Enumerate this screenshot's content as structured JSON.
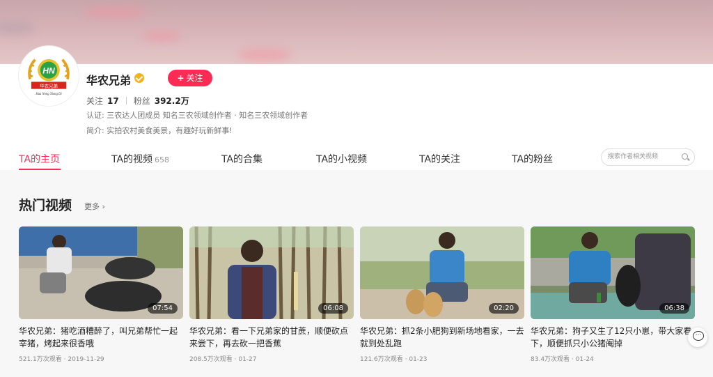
{
  "profile": {
    "name": "华农兄弟",
    "follow_label": "关注",
    "following_label": "关注",
    "following_count": "17",
    "followers_label": "粉丝",
    "followers_count": "392.2万",
    "certification": "认证: 三农达人团成员 知名三农领域创作者 · 知名三农领域创作者",
    "bio": "简介: 实拍农村美食美景，有趣好玩新鲜事!",
    "avatar_text": "华农兄弟",
    "avatar_logo": "HN",
    "avatar_sub": "Hua Nong Xiong Di",
    "verified_color": "#f3b31a"
  },
  "tabs": [
    {
      "label": "TA的主页",
      "count": ""
    },
    {
      "label": "TA的视频",
      "count": "658"
    },
    {
      "label": "TA的合集",
      "count": ""
    },
    {
      "label": "TA的小视频",
      "count": ""
    },
    {
      "label": "TA的关注",
      "count": ""
    },
    {
      "label": "TA的粉丝",
      "count": ""
    }
  ],
  "search": {
    "placeholder": "搜索作者相关视频"
  },
  "section": {
    "title": "热门视频",
    "more": "更多"
  },
  "videos": [
    {
      "title": "华农兄弟：猪吃酒糟醉了，叫兄弟帮忙一起宰猪，烤起来很香哦",
      "duration": "07:54",
      "views": "521.1万次观看",
      "date": "2019-11-29"
    },
    {
      "title": "华农兄弟：看一下兄弟家的甘蔗，顺便砍点来尝下，再去砍一把香蕉",
      "duration": "06:08",
      "views": "208.5万次观看",
      "date": "01-27"
    },
    {
      "title": "华农兄弟：抓2条小肥狗到新场地看家，一去就到处乱跑",
      "duration": "02:20",
      "views": "121.6万次观看",
      "date": "01-23"
    },
    {
      "title": "华农兄弟：狗子又生了12只小崽，带大家看下，顺便抓只小公猪阉掉",
      "duration": "06:38",
      "views": "83.4万次观看",
      "date": "01-24"
    }
  ],
  "colors": {
    "accent": "#fe2c55"
  }
}
